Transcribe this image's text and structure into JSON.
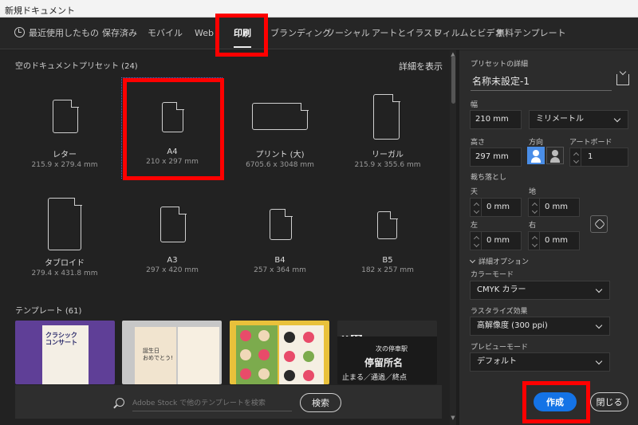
{
  "window": {
    "title": "新規ドキュメント"
  },
  "tabs": [
    {
      "label": "最近使用したもの"
    },
    {
      "label": "保存済み"
    },
    {
      "label": "モバイル"
    },
    {
      "label": "Web"
    },
    {
      "label": "印刷",
      "active": true
    },
    {
      "label": "ブランディング"
    },
    {
      "label": "ソーシャル"
    },
    {
      "label": "アートとイラスト"
    },
    {
      "label": "フィルムとビデオ"
    },
    {
      "label": "無料テンプレート"
    }
  ],
  "presets_section": {
    "label": "空のドキュメントプリセット (24)",
    "view_all": "詳細を表示"
  },
  "presets": [
    {
      "name": "レター",
      "size": "215.9 x 279.4 mm"
    },
    {
      "name": "A4",
      "size": "210 x 297 mm",
      "selected": true
    },
    {
      "name": "プリント (大)",
      "size": "6705.6 x 3048 mm"
    },
    {
      "name": "リーガル",
      "size": "215.9 x 355.6 mm"
    },
    {
      "name": "タブロイド",
      "size": "279.4 x 431.8 mm"
    },
    {
      "name": "A3",
      "size": "297 x 420 mm"
    },
    {
      "name": "B4",
      "size": "257 x 364 mm"
    },
    {
      "name": "B5",
      "size": "182 x 257 mm"
    }
  ],
  "templates_section": {
    "label": "テンプレート (61)"
  },
  "templates": {
    "t1_text": "クラシック\nコンサート",
    "t2_text": "誕生日\nおめでとう!",
    "t4_num1": "11",
    "t4_num2": "12",
    "t4_line1": "次の停車駅",
    "t4_line2": "停留所名",
    "t4_line3": "止まる／通過／終点"
  },
  "search": {
    "placeholder": "Adobe Stock で他のテンプレートを検索",
    "button": "検索"
  },
  "details": {
    "header": "プリセットの詳細",
    "doc_name": "名称未設定-1",
    "width_label": "幅",
    "width_value": "210 mm",
    "unit": "ミリメートル",
    "height_label": "高さ",
    "height_value": "297 mm",
    "orientation_label": "方向",
    "artboard_label": "アートボード",
    "artboard_value": "1",
    "bleed_label": "裁ち落とし",
    "bleed_top_label": "天",
    "bleed_top": "0 mm",
    "bleed_bottom_label": "地",
    "bleed_bottom": "0 mm",
    "bleed_left_label": "左",
    "bleed_left": "0 mm",
    "bleed_right_label": "右",
    "bleed_right": "0 mm",
    "advanced_label": "詳細オプション",
    "color_mode_label": "カラーモード",
    "color_mode": "CMYK カラー",
    "raster_label": "ラスタライズ効果",
    "raster": "高解像度 (300 ppi)",
    "preview_label": "プレビューモード",
    "preview": "デフォルト"
  },
  "actions": {
    "create": "作成",
    "close": "閉じる"
  },
  "colors": {
    "highlight": "#ff0000",
    "primary": "#1473e6"
  }
}
